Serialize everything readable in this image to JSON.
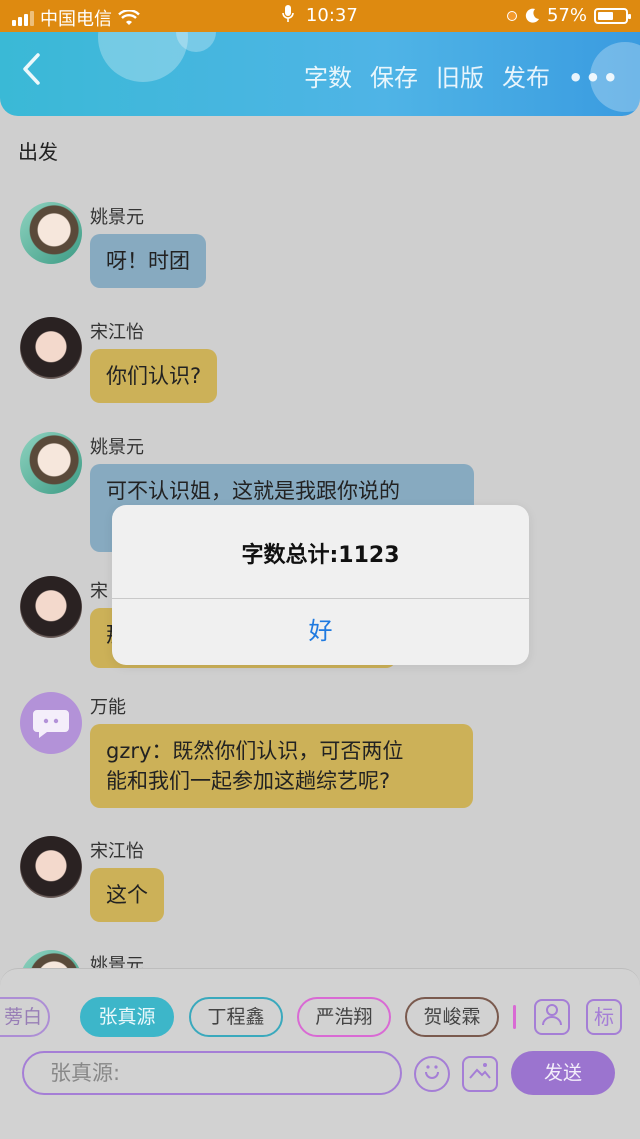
{
  "status_bar": {
    "carrier": "中国电信",
    "time": "10:37",
    "battery": "57%",
    "battery_level": 0.57
  },
  "header": {
    "back_icon": "chevron-left-icon",
    "actions": [
      "字数",
      "保存",
      "旧版",
      "发布"
    ],
    "more": "•••"
  },
  "chapter_title": "出发",
  "messages": [
    {
      "name": "姚景元",
      "text": "呀！时团",
      "color": "#87aac0"
    },
    {
      "name": "宋江怡",
      "text": "你们认识?",
      "color": "#ccb158"
    },
    {
      "name": "姚景元",
      "text": "可不认识姐，这就是我跟你说的",
      "color": "#87aac0"
    },
    {
      "name": "宋",
      "text": "那",
      "color": "#ccb158"
    },
    {
      "name": "万能",
      "text": "gzry：既然你们认识，可否两位\n能和我们一起参加这趟综艺呢?",
      "color": "#ccb158"
    },
    {
      "name": "宋江怡",
      "text": "这个",
      "color": "#ccb158"
    },
    {
      "name": "姚景元"
    }
  ],
  "dialog": {
    "title": "字数总计:1123",
    "ok": "好"
  },
  "chips": [
    {
      "label": "旁白",
      "visible": "蒡白"
    },
    {
      "label": "张真源",
      "selected": true
    },
    {
      "label": "丁程鑫"
    },
    {
      "label": "严浩翔"
    },
    {
      "label": "贺峻霖"
    }
  ],
  "side_buttons": {
    "mark": "标"
  },
  "input": {
    "value": "张真源:"
  },
  "send_label": "发送",
  "colors": {
    "accent": "#9b74cf",
    "header": "#3ab9d6",
    "dialog_button": "#1f7ae0"
  }
}
